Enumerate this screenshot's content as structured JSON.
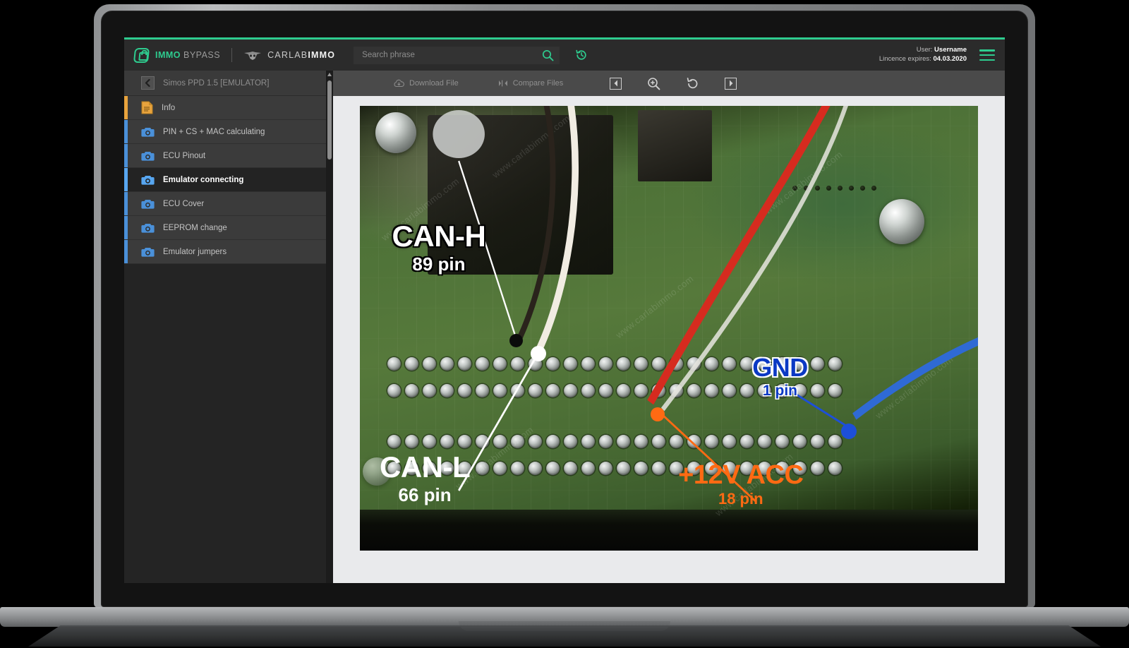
{
  "brand": {
    "primary_first": "IMMO",
    "primary_second": " BYPASS",
    "secondary_first": "CARLAB",
    "secondary_second": "IMMO",
    "accent_green": "#2ecc8f"
  },
  "search": {
    "placeholder": "Search phrase",
    "value": "",
    "search_icon": "search-icon",
    "history_icon": "history-icon"
  },
  "account": {
    "user_label": "User: ",
    "user_name": "Username",
    "licence_label": "Lincence expires: ",
    "licence_date": "04.03.2020",
    "menu_icon": "hamburger-menu-icon"
  },
  "sidebar": {
    "header_title": "Simos PPD 1.5 [EMULATOR]",
    "back_icon": "chevron-left-icon",
    "items": [
      {
        "label": "Info",
        "icon": "document-icon",
        "accent": "#e8a33d",
        "active": false
      },
      {
        "label": "PIN + CS + MAC calculating",
        "icon": "camera-icon",
        "accent": "#4a90d9",
        "active": false
      },
      {
        "label": "ECU Pinout",
        "icon": "camera-icon",
        "accent": "#4a90d9",
        "active": false
      },
      {
        "label": "Emulator connecting",
        "icon": "camera-icon",
        "accent": "#57a6f0",
        "active": true
      },
      {
        "label": "ECU Cover",
        "icon": "camera-icon",
        "accent": "#4a90d9",
        "active": false
      },
      {
        "label": "EEPROM change",
        "icon": "camera-icon",
        "accent": "#4a90d9",
        "active": false
      },
      {
        "label": "Emulator jumpers",
        "icon": "camera-icon",
        "accent": "#4a90d9",
        "active": false
      }
    ]
  },
  "toolbar": {
    "download_label": "Download File",
    "download_icon": "cloud-download-icon",
    "compare_label": "Compare Files",
    "compare_icon": "compare-files-icon",
    "prev_icon": "previous-image-icon",
    "zoom_icon": "zoom-in-icon",
    "rotate_icon": "rotate-left-icon",
    "next_icon": "next-image-icon"
  },
  "photo": {
    "watermark_text": "www.carlabimmo.com",
    "annotations": [
      {
        "name": "can-h",
        "title": "CAN-H",
        "pin": "89 pin",
        "color": "#ffffff",
        "style": "white"
      },
      {
        "name": "can-l",
        "title": "CAN-L",
        "pin": "66 pin",
        "color": "#ffffff",
        "style": "plain"
      },
      {
        "name": "gnd",
        "title": "GND",
        "pin": "1 pin",
        "color": "#0b39c4",
        "style": "blue"
      },
      {
        "name": "plus12v-acc",
        "title": "+12V ACC",
        "pin": "18 pin",
        "color": "#ff6a13",
        "style": "orange"
      }
    ],
    "markers": [
      {
        "name": "can-h-marker",
        "color": "#000000"
      },
      {
        "name": "can-l-marker",
        "color": "#ffffff"
      },
      {
        "name": "plus12v-marker",
        "color": "#ff6a13"
      },
      {
        "name": "gnd-marker",
        "color": "#1d4fd8"
      }
    ]
  }
}
